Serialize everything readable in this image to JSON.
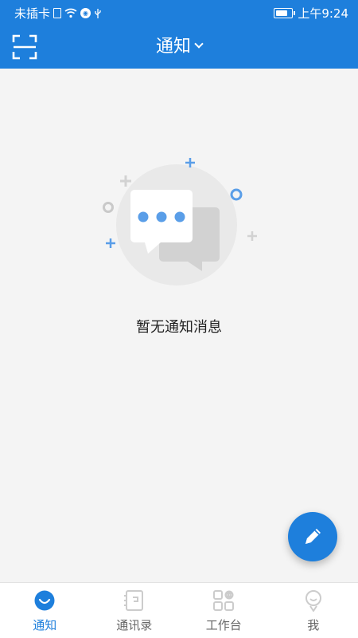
{
  "status_bar": {
    "carrier": "未插卡",
    "time": "上午9:24",
    "battery_level": 0.8
  },
  "header": {
    "title": "通知",
    "left_icon": "scan-icon",
    "title_icon": "chevron-down-icon"
  },
  "main": {
    "empty_message": "暂无通知消息"
  },
  "fab": {
    "icon": "pencil-icon"
  },
  "bottom_nav": {
    "items": [
      {
        "label": "通知",
        "icon": "notification-icon",
        "active": true
      },
      {
        "label": "通讯录",
        "icon": "contacts-icon",
        "active": false
      },
      {
        "label": "工作台",
        "icon": "workbench-icon",
        "active": false
      },
      {
        "label": "我",
        "icon": "profile-icon",
        "active": false
      }
    ]
  },
  "colors": {
    "primary": "#1e7fdc",
    "background": "#f4f4f4",
    "inactive": "#cccccc"
  }
}
